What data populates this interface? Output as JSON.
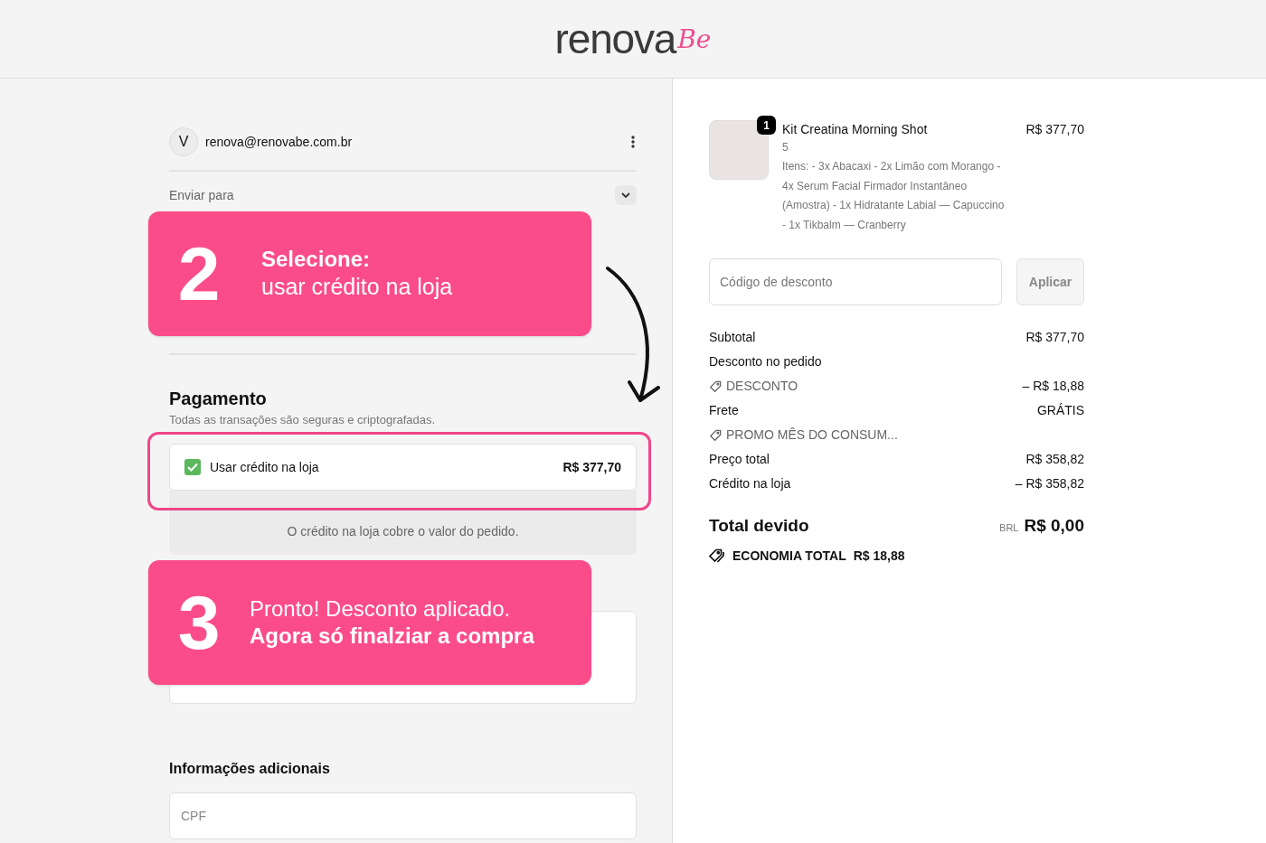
{
  "logo": {
    "main": "renova",
    "script": "Be"
  },
  "account": {
    "initial": "V",
    "email": "renova@renovabe.com.br"
  },
  "shipping": {
    "label": "Enviar para",
    "expanded": false
  },
  "payment": {
    "title": "Pagamento",
    "subtitle": "Todas as transações são seguras e criptografadas.",
    "store_credit": {
      "label": "Usar crédito na loja",
      "amount": "R$ 377,70",
      "checked": true
    },
    "note": "O crédito na loja cobre o valor do pedido."
  },
  "additional": {
    "title": "Informações adicionais",
    "cpf": {
      "placeholder": "CPF"
    }
  },
  "callouts": [
    {
      "number": "2",
      "title": "Selecione:",
      "text": "usar crédito na loja"
    },
    {
      "number": "3",
      "title": "Pronto! Desconto aplicado.",
      "text": "Agora só finalziar a compra"
    }
  ],
  "order": {
    "item": {
      "quantity": "1",
      "name": "Kit Creatina Morning Shot",
      "variant": "5",
      "details": "Itens: - 3x Abacaxi - 2x Limão com Morango - 4x Serum Facial Firmador Instantâneo (Amostra) - 1x Hidratante Labial — Capuccino - 1x Tikbalm — Cranberry",
      "price": "R$ 377,70"
    },
    "discount_field": {
      "placeholder": "Código de desconto"
    },
    "apply_button": "Aplicar",
    "lines": [
      {
        "kind": "line",
        "label": "Subtotal",
        "value": "R$ 377,70"
      },
      {
        "kind": "line",
        "label": "Desconto no pedido"
      },
      {
        "kind": "code",
        "label": "DESCONTO",
        "value": "– R$ 18,88"
      },
      {
        "kind": "line",
        "label": "Frete",
        "value": "GRÁTIS"
      },
      {
        "kind": "code",
        "label": "PROMO MÊS DO CONSUM..."
      },
      {
        "kind": "line",
        "label": "Preço total",
        "value": "R$ 358,82"
      },
      {
        "kind": "line",
        "label": "Crédito na loja",
        "value": "– R$ 358,82"
      }
    ],
    "total": {
      "label": "Total devido",
      "currency": "BRL",
      "value": "R$ 0,00"
    },
    "savings": {
      "label": "ECONOMIA TOTAL",
      "value": "R$ 18,88"
    }
  }
}
